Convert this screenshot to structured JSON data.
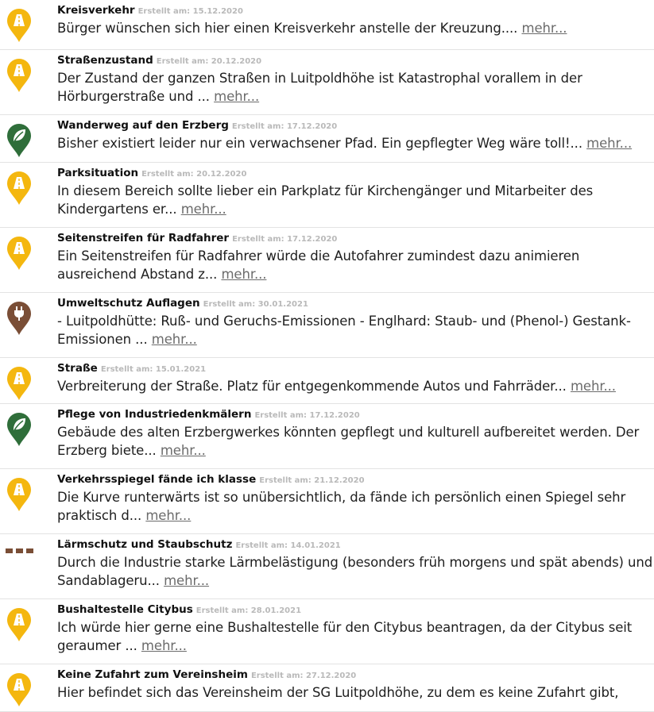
{
  "colors": {
    "yellow": "#f4b70f",
    "green": "#2f6e3a",
    "brown": "#7a4e36",
    "more": "#6b6b6b"
  },
  "items": [
    {
      "icon": "road-pin-icon",
      "color": "#f4b70f",
      "title": "Kreisverkehr",
      "meta": "Erstellt am: 15.12.2020",
      "text": "Bürger wünschen sich hier einen Kreisverkehr anstelle der Kreuzung....",
      "more": "mehr..."
    },
    {
      "icon": "road-pin-icon",
      "color": "#f4b70f",
      "title": "Straßenzustand",
      "meta": "Erstellt am: 20.12.2020",
      "text": "Der Zustand der ganzen Straßen in Luitpoldhöhe ist Katastrophal vorallem in der Hörburgerstraße und ...",
      "more": "mehr..."
    },
    {
      "icon": "leaf-pin-icon",
      "color": "#2f6e3a",
      "title": "Wanderweg auf den Erzberg",
      "meta": "Erstellt am: 17.12.2020",
      "text": "Bisher existiert leider nur ein verwachsener Pfad. Ein gepflegter Weg wäre toll!...",
      "more": "mehr..."
    },
    {
      "icon": "road-pin-icon",
      "color": "#f4b70f",
      "title": "Parksituation",
      "meta": "Erstellt am: 20.12.2020",
      "text": "In diesem Bereich sollte lieber ein Parkplatz für Kirchengänger und Mitarbeiter des Kindergartens er...",
      "more": "mehr..."
    },
    {
      "icon": "road-pin-icon",
      "color": "#f4b70f",
      "title": "Seitenstreifen für Radfahrer",
      "meta": "Erstellt am: 17.12.2020",
      "text": "Ein Seitenstreifen für Radfahrer würde die Autofahrer zumindest dazu animieren ausreichend Abstand z...",
      "more": "mehr..."
    },
    {
      "icon": "plug-pin-icon",
      "color": "#7a4e36",
      "title": "Umweltschutz Auflagen",
      "meta": "Erstellt am: 30.01.2021",
      "text": "- Luitpoldhütte: Ruß- und Geruchs-Emissionen - Englhard: Staub- und (Phenol-) Gestank-Emissionen ...",
      "more": "mehr..."
    },
    {
      "icon": "road-pin-icon",
      "color": "#f4b70f",
      "title": "Straße",
      "meta": "Erstellt am: 15.01.2021",
      "text": "Verbreiterung der Straße. Platz für entgegenkommende Autos und Fahrräder...",
      "more": "mehr..."
    },
    {
      "icon": "leaf-pin-icon",
      "color": "#2f6e3a",
      "title": "Pflege von Industriedenkmälern",
      "meta": "Erstellt am: 17.12.2020",
      "text": "Gebäude des alten Erzbergwerkes könnten gepflegt und kulturell aufbereitet werden. Der Erzberg biete...",
      "more": "mehr..."
    },
    {
      "icon": "road-pin-icon",
      "color": "#f4b70f",
      "title": "Verkehrsspiegel fände ich klasse",
      "meta": "Erstellt am: 21.12.2020",
      "text": "Die Kurve runterwärts ist so unübersichtlich, da fände ich persönlich einen Spiegel sehr praktisch d...",
      "more": "mehr..."
    },
    {
      "icon": "dashed-line-icon",
      "color": "#7a4e36",
      "title": "Lärmschutz und Staubschutz",
      "meta": "Erstellt am: 14.01.2021",
      "text": "Durch die Industrie starke Lärmbelästigung (besonders früh morgens und spät abends) und Sandablageru...",
      "more": "mehr..."
    },
    {
      "icon": "road-pin-icon",
      "color": "#f4b70f",
      "title": "Bushaltestelle Citybus",
      "meta": "Erstellt am: 28.01.2021",
      "text": "Ich würde hier gerne eine Bushaltestelle für den Citybus beantragen, da der Citybus seit geraumer ...",
      "more": "mehr..."
    },
    {
      "icon": "road-pin-icon",
      "color": "#f4b70f",
      "title": "Keine Zufahrt zum Vereinsheim",
      "meta": "Erstellt am: 27.12.2020",
      "text": "Hier befindet sich das Vereinsheim der SG Luitpoldhöhe, zu dem es keine Zufahrt gibt,",
      "more": ""
    }
  ]
}
